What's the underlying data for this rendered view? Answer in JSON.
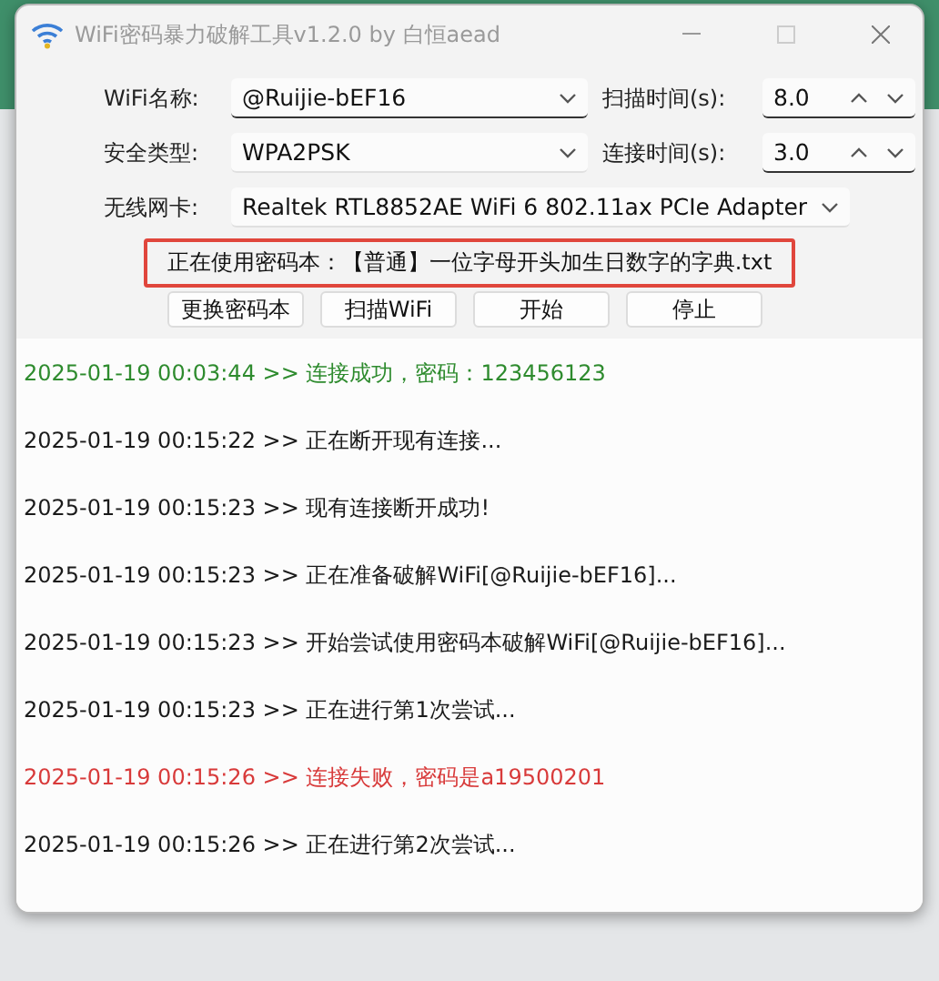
{
  "window": {
    "title": "WiFi密码暴力破解工具v1.2.0 by 白恒aead"
  },
  "form": {
    "wifi_name": {
      "label": "WiFi名称:",
      "value": "@Ruijie-bEF16"
    },
    "scan_time": {
      "label": "扫描时间(s):",
      "value": "8.0"
    },
    "security_type": {
      "label": "安全类型:",
      "value": "WPA2PSK"
    },
    "connect_time": {
      "label": "连接时间(s):",
      "value": "3.0"
    },
    "adapter": {
      "label": "无线网卡:",
      "value": "Realtek RTL8852AE WiFi 6 802.11ax PCIe Adapter"
    }
  },
  "dictionary_notice": "正在使用密码本：【普通】一位字母开头加生日数字的字典.txt",
  "buttons": [
    "更换密码本",
    "扫描WiFi",
    "开始",
    "停止"
  ],
  "log": [
    {
      "kind": "success",
      "time": "2025-01-19 00:03:44",
      "message": ">> 连接成功，密码：123456123"
    },
    {
      "kind": "info",
      "time": "2025-01-19 00:15:22",
      "message": ">> 正在断开现有连接..."
    },
    {
      "kind": "info",
      "time": "2025-01-19 00:15:23",
      "message": ">> 现有连接断开成功!"
    },
    {
      "kind": "info",
      "time": "2025-01-19 00:15:23",
      "message": ">> 正在准备破解WiFi[@Ruijie-bEF16]..."
    },
    {
      "kind": "info",
      "time": "2025-01-19 00:15:23",
      "message": ">> 开始尝试使用密码本破解WiFi[@Ruijie-bEF16]..."
    },
    {
      "kind": "info",
      "time": "2025-01-19 00:15:23",
      "message": ">> 正在进行第1次尝试..."
    },
    {
      "kind": "error",
      "time": "2025-01-19 00:15:26",
      "message": ">> 连接失败，密码是a19500201"
    },
    {
      "kind": "info",
      "time": "2025-01-19 00:15:26",
      "message": ">> 正在进行第2次尝试..."
    }
  ]
}
